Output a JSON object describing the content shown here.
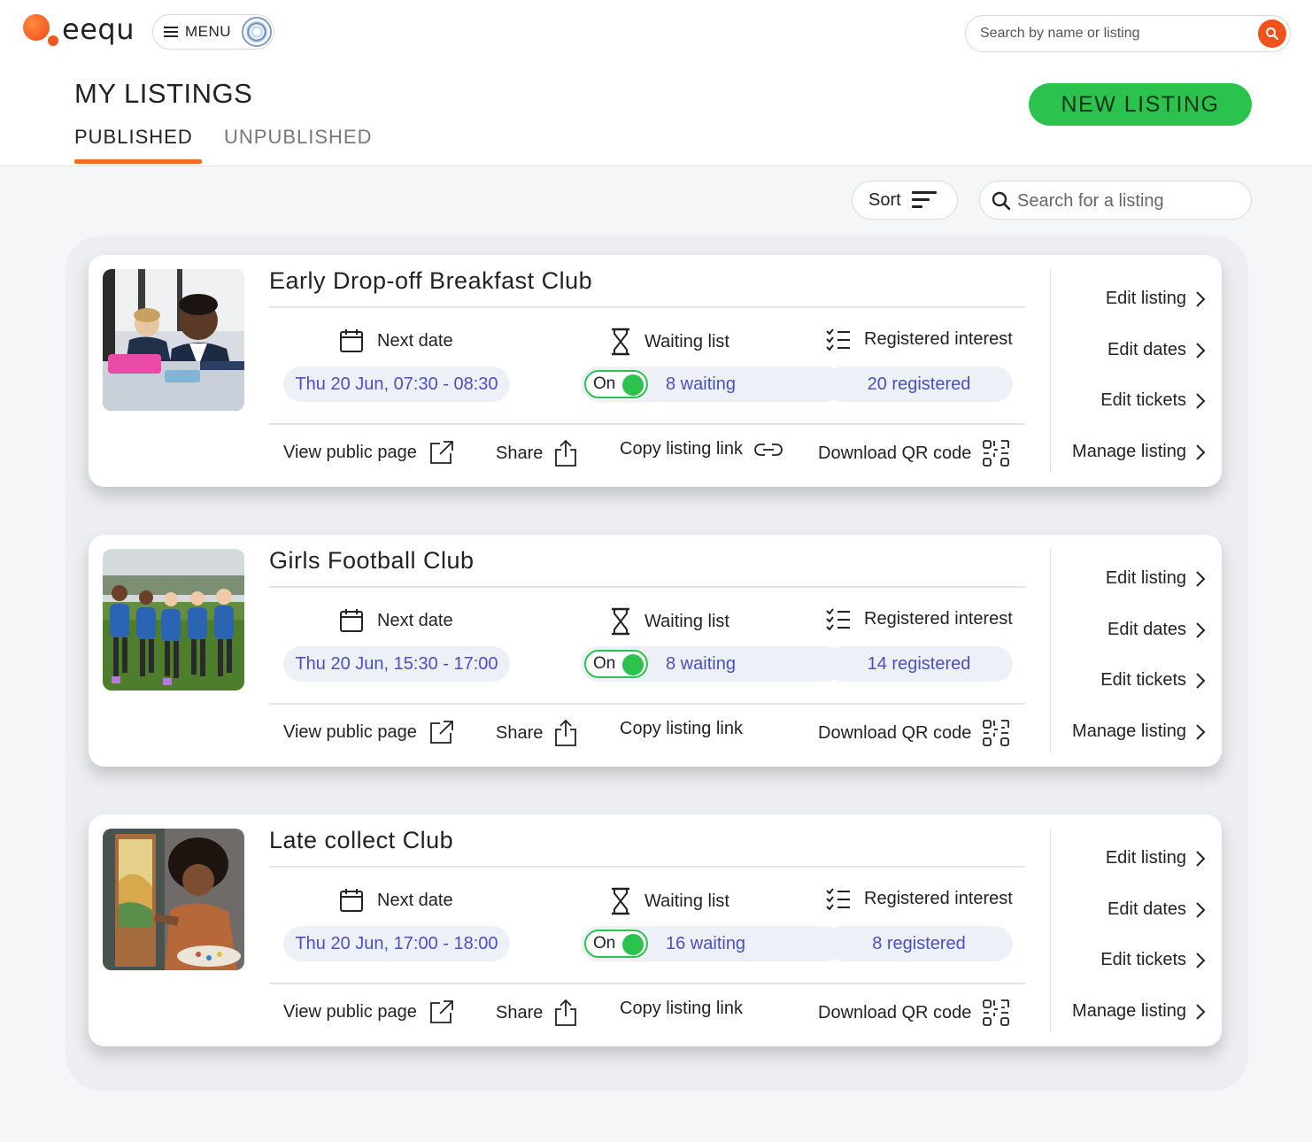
{
  "brand": {
    "logo_text": "eequ",
    "accent": "#f26b21",
    "green": "#2bc24e",
    "link": "#4a4fc4"
  },
  "topbar": {
    "menu_label": "MENU",
    "search_placeholder": "Search by name or listing"
  },
  "header": {
    "title": "MY LISTINGS",
    "tabs": [
      {
        "label": "PUBLISHED",
        "active": true
      },
      {
        "label": "UNPUBLISHED",
        "active": false
      }
    ],
    "new_listing_label": "NEW LISTING"
  },
  "tools": {
    "sort_label": "Sort",
    "search_placeholder": "Search for a listing"
  },
  "labels": {
    "next_date": "Next date",
    "waiting_list": "Waiting list",
    "registered_interest": "Registered interest",
    "toggle_on": "On",
    "view_public_page": "View public page",
    "share": "Share",
    "copy_listing_link": "Copy listing link",
    "download_qr": "Download QR code",
    "edit_listing": "Edit listing",
    "edit_dates": "Edit dates",
    "edit_tickets": "Edit tickets",
    "manage_listing": "Manage listing"
  },
  "listings": [
    {
      "title": "Early Drop-off Breakfast Club",
      "next_date": "Thu 20 Jun, 07:30 - 08:30",
      "waiting_on": true,
      "waiting": "8 waiting",
      "registered": "20 registered",
      "image": "breakfast-club-photo"
    },
    {
      "title": "Girls Football Club",
      "next_date": "Thu 20 Jun, 15:30 - 17:00",
      "waiting_on": true,
      "waiting": "8 waiting",
      "registered": "14 registered",
      "image": "football-club-photo"
    },
    {
      "title": "Late collect Club",
      "next_date": "Thu 20 Jun, 17:00 - 18:00",
      "waiting_on": true,
      "waiting": "16 waiting",
      "registered": "8 registered",
      "image": "painting-club-photo"
    }
  ]
}
